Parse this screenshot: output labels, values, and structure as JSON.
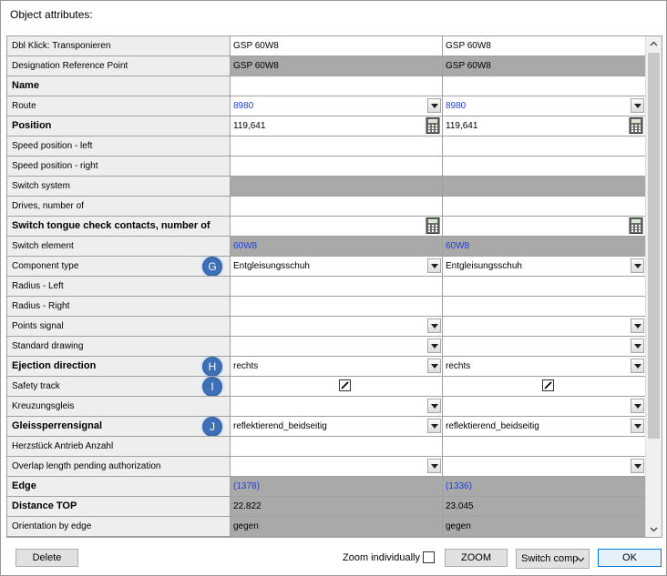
{
  "dialog": {
    "title": "Object attributes:"
  },
  "rows": [
    {
      "label": "Dbl Klick: Transponieren",
      "bold": false,
      "gray": false,
      "v1": "GSP 60W8",
      "v2": "GSP 60W8",
      "blue": false,
      "ctrl": "",
      "badge": ""
    },
    {
      "label": "Designation Reference Point",
      "bold": false,
      "gray": true,
      "v1": "GSP 60W8",
      "v2": "GSP 60W8",
      "blue": false,
      "ctrl": "",
      "badge": ""
    },
    {
      "label": "Name",
      "bold": true,
      "gray": false,
      "v1": "",
      "v2": "",
      "blue": false,
      "ctrl": "",
      "badge": ""
    },
    {
      "label": "Route",
      "bold": false,
      "gray": false,
      "v1": "8980",
      "v2": "8980",
      "blue": true,
      "ctrl": "dropdown",
      "badge": ""
    },
    {
      "label": "Position",
      "bold": true,
      "gray": false,
      "v1": "119,641",
      "v2": "119,641",
      "blue": false,
      "ctrl": "calc",
      "badge": ""
    },
    {
      "label": "Speed position - left",
      "bold": false,
      "gray": false,
      "v1": "",
      "v2": "",
      "blue": false,
      "ctrl": "",
      "badge": ""
    },
    {
      "label": "Speed position - right",
      "bold": false,
      "gray": false,
      "v1": "",
      "v2": "",
      "blue": false,
      "ctrl": "",
      "badge": ""
    },
    {
      "label": "Switch system",
      "bold": false,
      "gray": true,
      "v1": "",
      "v2": "",
      "blue": false,
      "ctrl": "",
      "badge": ""
    },
    {
      "label": "Drives, number of",
      "bold": false,
      "gray": false,
      "v1": "",
      "v2": "",
      "blue": false,
      "ctrl": "",
      "badge": ""
    },
    {
      "label": "Switch tongue check contacts, number of",
      "bold": true,
      "gray": false,
      "v1": "",
      "v2": "",
      "blue": false,
      "ctrl": "calc",
      "badge": ""
    },
    {
      "label": "Switch element",
      "bold": false,
      "gray": true,
      "v1": "60W8",
      "v2": "60W8",
      "blue": true,
      "ctrl": "",
      "badge": ""
    },
    {
      "label": "Component type",
      "bold": false,
      "gray": false,
      "v1": "Entgleisungsschuh",
      "v2": "Entgleisungsschuh",
      "blue": false,
      "ctrl": "dropdown",
      "badge": "G"
    },
    {
      "label": "Radius - Left",
      "bold": false,
      "gray": false,
      "v1": "",
      "v2": "",
      "blue": false,
      "ctrl": "",
      "badge": ""
    },
    {
      "label": "Radius - Right",
      "bold": false,
      "gray": false,
      "v1": "",
      "v2": "",
      "blue": false,
      "ctrl": "",
      "badge": ""
    },
    {
      "label": "Points signal",
      "bold": false,
      "gray": false,
      "v1": "",
      "v2": "",
      "blue": false,
      "ctrl": "dropdown",
      "badge": ""
    },
    {
      "label": "Standard drawing",
      "bold": false,
      "gray": false,
      "v1": "",
      "v2": "",
      "blue": false,
      "ctrl": "dropdown",
      "badge": ""
    },
    {
      "label": "Ejection direction",
      "bold": true,
      "gray": false,
      "v1": "rechts",
      "v2": "rechts",
      "blue": false,
      "ctrl": "dropdown",
      "badge": "H"
    },
    {
      "label": "Safety track",
      "bold": false,
      "gray": false,
      "v1": "",
      "v2": "",
      "blue": false,
      "ctrl": "checkbox",
      "badge": "I"
    },
    {
      "label": "Kreuzungsgleis",
      "bold": false,
      "gray": false,
      "v1": "",
      "v2": "",
      "blue": false,
      "ctrl": "dropdown",
      "badge": ""
    },
    {
      "label": "Gleissperrensignal",
      "bold": true,
      "gray": false,
      "v1": "reflektierend_beidseitig",
      "v2": "reflektierend_beidseitig",
      "blue": false,
      "ctrl": "dropdown",
      "badge": "J"
    },
    {
      "label": "Herzstück Antrieb Anzahl",
      "bold": false,
      "gray": false,
      "v1": "",
      "v2": "",
      "blue": false,
      "ctrl": "",
      "badge": ""
    },
    {
      "label": "Overlap length pending authorization",
      "bold": false,
      "gray": false,
      "v1": "",
      "v2": "",
      "blue": false,
      "ctrl": "dropdown",
      "badge": ""
    },
    {
      "label": "Edge",
      "bold": true,
      "gray": true,
      "v1": "(1378)",
      "v2": "(1336)",
      "blue": true,
      "ctrl": "",
      "badge": ""
    },
    {
      "label": "Distance TOP",
      "bold": true,
      "gray": true,
      "v1": "22.822",
      "v2": "23.045",
      "blue": false,
      "ctrl": "",
      "badge": ""
    },
    {
      "label": "Orientation by edge",
      "bold": false,
      "gray": true,
      "v1": "gegen",
      "v2": "gegen",
      "blue": false,
      "ctrl": "",
      "badge": ""
    }
  ],
  "footer": {
    "delete_label": "Delete",
    "zoom_individually_label": "Zoom individually",
    "zoom_label": "ZOOM",
    "switch_select_value": "Switch comp",
    "ok_label": "OK"
  },
  "colors": {
    "gray_cell": "#a9a9a9",
    "label_cell": "#eeeeee",
    "link_blue": "#1f3fdc",
    "badge_blue": "#3c6fb5"
  }
}
